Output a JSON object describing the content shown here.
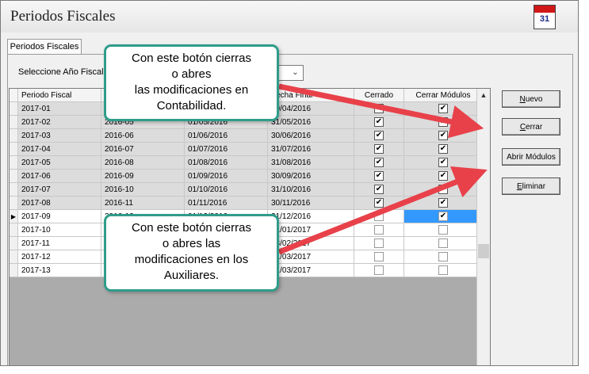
{
  "window": {
    "title": "Periodos Fiscales",
    "calendar_icon_number": "31"
  },
  "tab": {
    "label": "Periodos Fiscales"
  },
  "year_select": {
    "label": "Seleccione Año Fiscal:",
    "value": ""
  },
  "grid": {
    "columns": [
      "Periodo Fiscal",
      "",
      "",
      "Fecha Final",
      "Cerrado",
      "Cerrar Módulos"
    ],
    "rows": [
      {
        "periodo": "2017-01",
        "col2": "",
        "col3": "",
        "fin": "30/04/2016",
        "cerrado": true,
        "modulos": true,
        "state": "closed"
      },
      {
        "periodo": "2017-02",
        "col2": "2016-05",
        "col3": "01/05/2016",
        "fin": "31/05/2016",
        "cerrado": true,
        "modulos": true,
        "state": "closed"
      },
      {
        "periodo": "2017-03",
        "col2": "2016-06",
        "col3": "01/06/2016",
        "fin": "30/06/2016",
        "cerrado": true,
        "modulos": true,
        "state": "closed"
      },
      {
        "periodo": "2017-04",
        "col2": "2016-07",
        "col3": "01/07/2016",
        "fin": "31/07/2016",
        "cerrado": true,
        "modulos": true,
        "state": "closed"
      },
      {
        "periodo": "2017-05",
        "col2": "2016-08",
        "col3": "01/08/2016",
        "fin": "31/08/2016",
        "cerrado": true,
        "modulos": true,
        "state": "closed"
      },
      {
        "periodo": "2017-06",
        "col2": "2016-09",
        "col3": "01/09/2016",
        "fin": "30/09/2016",
        "cerrado": true,
        "modulos": true,
        "state": "closed"
      },
      {
        "periodo": "2017-07",
        "col2": "2016-10",
        "col3": "01/10/2016",
        "fin": "31/10/2016",
        "cerrado": true,
        "modulos": true,
        "state": "closed"
      },
      {
        "periodo": "2017-08",
        "col2": "2016-11",
        "col3": "01/11/2016",
        "fin": "30/11/2016",
        "cerrado": true,
        "modulos": true,
        "state": "closed"
      },
      {
        "periodo": "2017-09",
        "col2": "2016-12",
        "col3": "01/12/2016",
        "fin": "31/12/2016",
        "cerrado": false,
        "modulos": true,
        "state": "current"
      },
      {
        "periodo": "2017-10",
        "col2": "",
        "col3": "",
        "fin": "31/01/2017",
        "cerrado": false,
        "modulos": false,
        "state": "open"
      },
      {
        "periodo": "2017-11",
        "col2": "",
        "col3": "",
        "fin": "28/02/2017",
        "cerrado": false,
        "modulos": false,
        "state": "open"
      },
      {
        "periodo": "2017-12",
        "col2": "",
        "col3": "",
        "fin": "31/03/2017",
        "cerrado": false,
        "modulos": false,
        "state": "open"
      },
      {
        "periodo": "2017-13",
        "col2": "",
        "col3": "",
        "fin": "31/03/2017",
        "cerrado": false,
        "modulos": false,
        "state": "open"
      }
    ]
  },
  "buttons": {
    "nuevo": {
      "label": "Nuevo",
      "underline": "N",
      "rest": "uevo"
    },
    "cerrar": {
      "label": "Cerrar",
      "underline": "C",
      "rest": "errar"
    },
    "abrir_modulos": {
      "label": "Abrir Módulos"
    },
    "eliminar": {
      "label": "Eliminar",
      "underline": "E",
      "rest": "liminar"
    }
  },
  "callouts": {
    "top": "Con este botón cierras\no abres\nlas modificaciones en\nContabilidad.",
    "bottom": "Con este botón cierras\no abres las\nmodificaciones en los\nAuxiliares."
  },
  "colors": {
    "callout_border": "#2f9d8a",
    "arrow": "#e8414a",
    "selection": "#3399ff",
    "closed_row": "#dcdcdc"
  }
}
